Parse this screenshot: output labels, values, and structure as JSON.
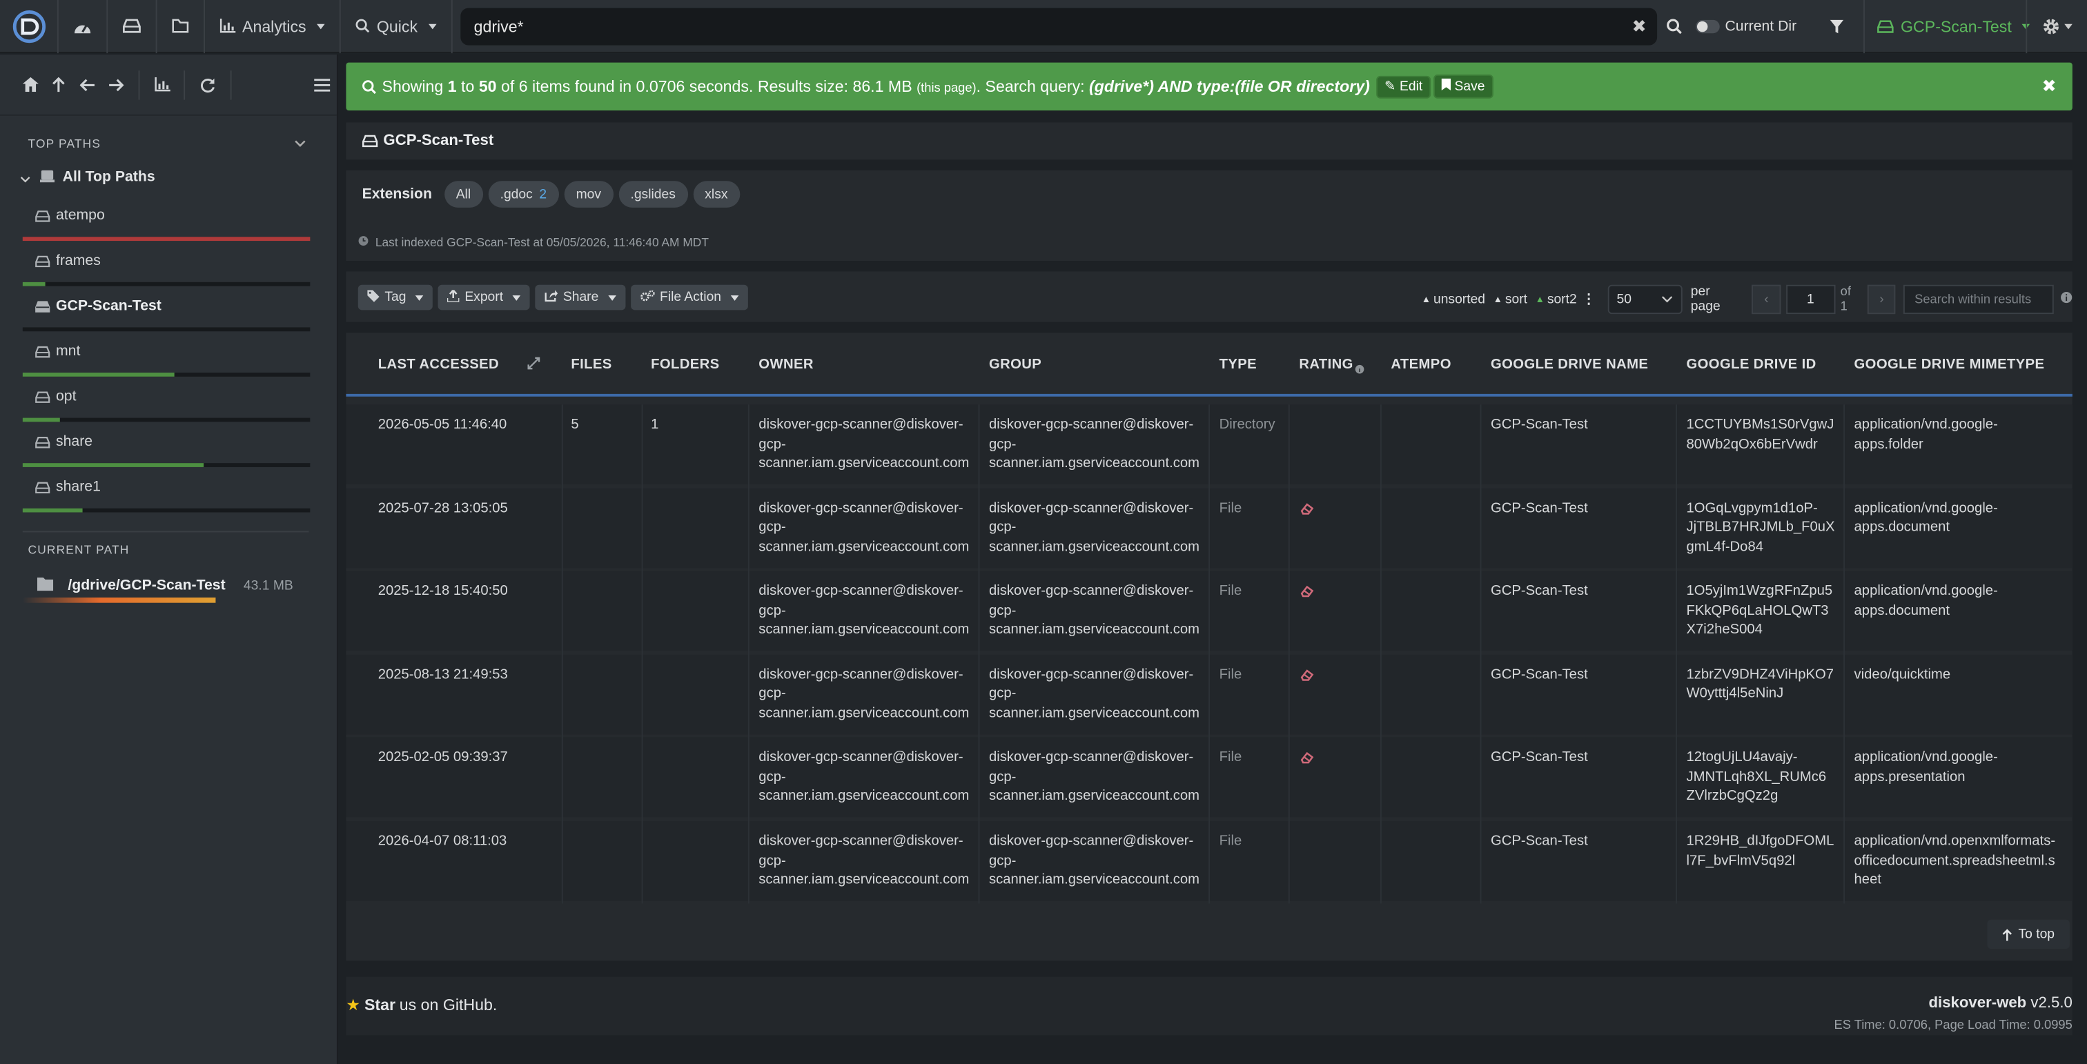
{
  "nav": {
    "analytics": "Analytics",
    "quick": "Quick",
    "search_value": "gdrive*",
    "current_dir": "Current Dir",
    "index_name": "GCP-Scan-Test",
    "accent": "#5cb85c"
  },
  "sidebar": {
    "top_paths_header": "TOP PATHS",
    "all_top_paths": "All Top Paths",
    "items": [
      {
        "label": "atempo",
        "usage": 1.0,
        "color": "#b03a3a"
      },
      {
        "label": "frames",
        "usage": 0.08,
        "color": "#4e8f42"
      },
      {
        "label": "GCP-Scan-Test",
        "usage": 0.0,
        "color": "#4e8f42"
      },
      {
        "label": "mnt",
        "usage": 0.53,
        "color": "#4e8f42"
      },
      {
        "label": "opt",
        "usage": 0.13,
        "color": "#4e8f42"
      },
      {
        "label": "share",
        "usage": 0.63,
        "color": "#4e8f42"
      },
      {
        "label": "share1",
        "usage": 0.21,
        "color": "#4e8f42"
      }
    ],
    "current_path_header": "CURRENT PATH",
    "current_path": "/gdrive/GCP-Scan-Test",
    "current_path_size": "43.1 MB"
  },
  "alert": {
    "t1": "Showing ",
    "from": "1",
    "t2": " to ",
    "to": "50",
    "t3": " of 6 items found in 0.0706 seconds. Results size: 86.1 MB ",
    "small": "(this page)",
    "t4": ". Search query: ",
    "query": "(gdrive*) AND type:(file OR directory)",
    "edit": "Edit",
    "save": "Save"
  },
  "path_title": "GCP-Scan-Test",
  "extension": {
    "label": "Extension",
    "pills": [
      {
        "label": "All",
        "count": ""
      },
      {
        "label": ".gdoc",
        "count": "2"
      },
      {
        "label": "mov",
        "count": ""
      },
      {
        "label": ".gslides",
        "count": ""
      },
      {
        "label": "xlsx",
        "count": ""
      }
    ],
    "last_indexed": "Last indexed GCP-Scan-Test at 05/05/2026, 11:46:40 AM MDT"
  },
  "toolbar": {
    "tag": "Tag",
    "export": "Export",
    "share": "Share",
    "file_action": "File Action",
    "unsorted": "unsorted",
    "sort": "sort",
    "sort2": "sort2",
    "per_page_value": "50",
    "per_page": "per page",
    "page": "1",
    "of": "of 1",
    "search_placeholder": "Search within results"
  },
  "table": {
    "headers": [
      "LAST ACCESSED",
      "FILES",
      "FOLDERS",
      "OWNER",
      "GROUP",
      "TYPE",
      "RATING",
      "ATEMPO",
      "GOOGLE DRIVE NAME",
      "GOOGLE DRIVE ID",
      "GOOGLE DRIVE MIMETYPE"
    ],
    "rows": [
      {
        "accessed": "2026-05-05 11:46:40",
        "files": "5",
        "folders": "1",
        "owner": [
          "diskover-gcp-scanner@diskover-",
          "gcp-",
          "scanner.iam.gserviceaccount.com"
        ],
        "group": [
          "diskover-gcp-scanner@diskover-",
          "gcp-",
          "scanner.iam.gserviceaccount.com"
        ],
        "type": "Directory",
        "rating": false,
        "gd_name": "GCP-Scan-Test",
        "gd_id": [
          "1CCTUYBMs1S0rVgwJ",
          "80Wb2qOx6bErVwdr"
        ],
        "mime": [
          "application/vnd.google-",
          "apps.folder"
        ]
      },
      {
        "accessed": "2025-07-28 13:05:05",
        "files": "",
        "folders": "",
        "owner": [
          "diskover-gcp-scanner@diskover-",
          "gcp-",
          "scanner.iam.gserviceaccount.com"
        ],
        "group": [
          "diskover-gcp-scanner@diskover-",
          "gcp-",
          "scanner.iam.gserviceaccount.com"
        ],
        "type": "File",
        "rating": true,
        "gd_name": "GCP-Scan-Test",
        "gd_id": [
          "1OGqLvgpym1d1oP-",
          "JjTBLB7HRJMLb_F0uX",
          "gmL4f-Do84"
        ],
        "mime": [
          "application/vnd.google-",
          "apps.document"
        ]
      },
      {
        "accessed": "2025-12-18 15:40:50",
        "files": "",
        "folders": "",
        "owner": [
          "diskover-gcp-scanner@diskover-",
          "gcp-",
          "scanner.iam.gserviceaccount.com"
        ],
        "group": [
          "diskover-gcp-scanner@diskover-",
          "gcp-",
          "scanner.iam.gserviceaccount.com"
        ],
        "type": "File",
        "rating": true,
        "gd_name": "GCP-Scan-Test",
        "gd_id": [
          "1O5yjIm1WzgRFnZpu5",
          "FKkQP6qLaHOLQwT3",
          "X7i2heS004"
        ],
        "mime": [
          "application/vnd.google-",
          "apps.document"
        ]
      },
      {
        "accessed": "2025-08-13 21:49:53",
        "files": "",
        "folders": "",
        "owner": [
          "diskover-gcp-scanner@diskover-",
          "gcp-",
          "scanner.iam.gserviceaccount.com"
        ],
        "group": [
          "diskover-gcp-scanner@diskover-",
          "gcp-",
          "scanner.iam.gserviceaccount.com"
        ],
        "type": "File",
        "rating": true,
        "gd_name": "GCP-Scan-Test",
        "gd_id": [
          "1zbrZV9DHZ4ViHpKO7",
          "W0ytttj4l5eNinJ"
        ],
        "mime": [
          "video/quicktime"
        ]
      },
      {
        "accessed": "2025-02-05 09:39:37",
        "files": "",
        "folders": "",
        "owner": [
          "diskover-gcp-scanner@diskover-",
          "gcp-",
          "scanner.iam.gserviceaccount.com"
        ],
        "group": [
          "diskover-gcp-scanner@diskover-",
          "gcp-",
          "scanner.iam.gserviceaccount.com"
        ],
        "type": "File",
        "rating": true,
        "gd_name": "GCP-Scan-Test",
        "gd_id": [
          "12togUjLU4avajy-",
          "JMNTLqh8XL_RUMc6",
          "ZVlrzbCgQz2g"
        ],
        "mime": [
          "application/vnd.google-",
          "apps.presentation"
        ]
      },
      {
        "accessed": "2026-04-07 08:11:03",
        "files": "",
        "folders": "",
        "owner": [
          "diskover-gcp-scanner@diskover-",
          "gcp-",
          "scanner.iam.gserviceaccount.com"
        ],
        "group": [
          "diskover-gcp-scanner@diskover-",
          "gcp-",
          "scanner.iam.gserviceaccount.com"
        ],
        "type": "File",
        "rating": false,
        "gd_name": "GCP-Scan-Test",
        "gd_id": [
          "1R29HB_dIJfgoDFOML",
          "l7F_bvFlmV5q92l"
        ],
        "mime": [
          "application/vnd.openxmlformats-",
          "officedocument.spreadsheetml.s",
          "heet"
        ]
      }
    ]
  },
  "to_top": "To top",
  "footer": {
    "star": "Star",
    "star_rest": " us on GitHub.",
    "product": "diskover-web",
    "version": " v2.5.0",
    "timing": "ES Time: 0.0706, Page Load Time: 0.0995"
  }
}
